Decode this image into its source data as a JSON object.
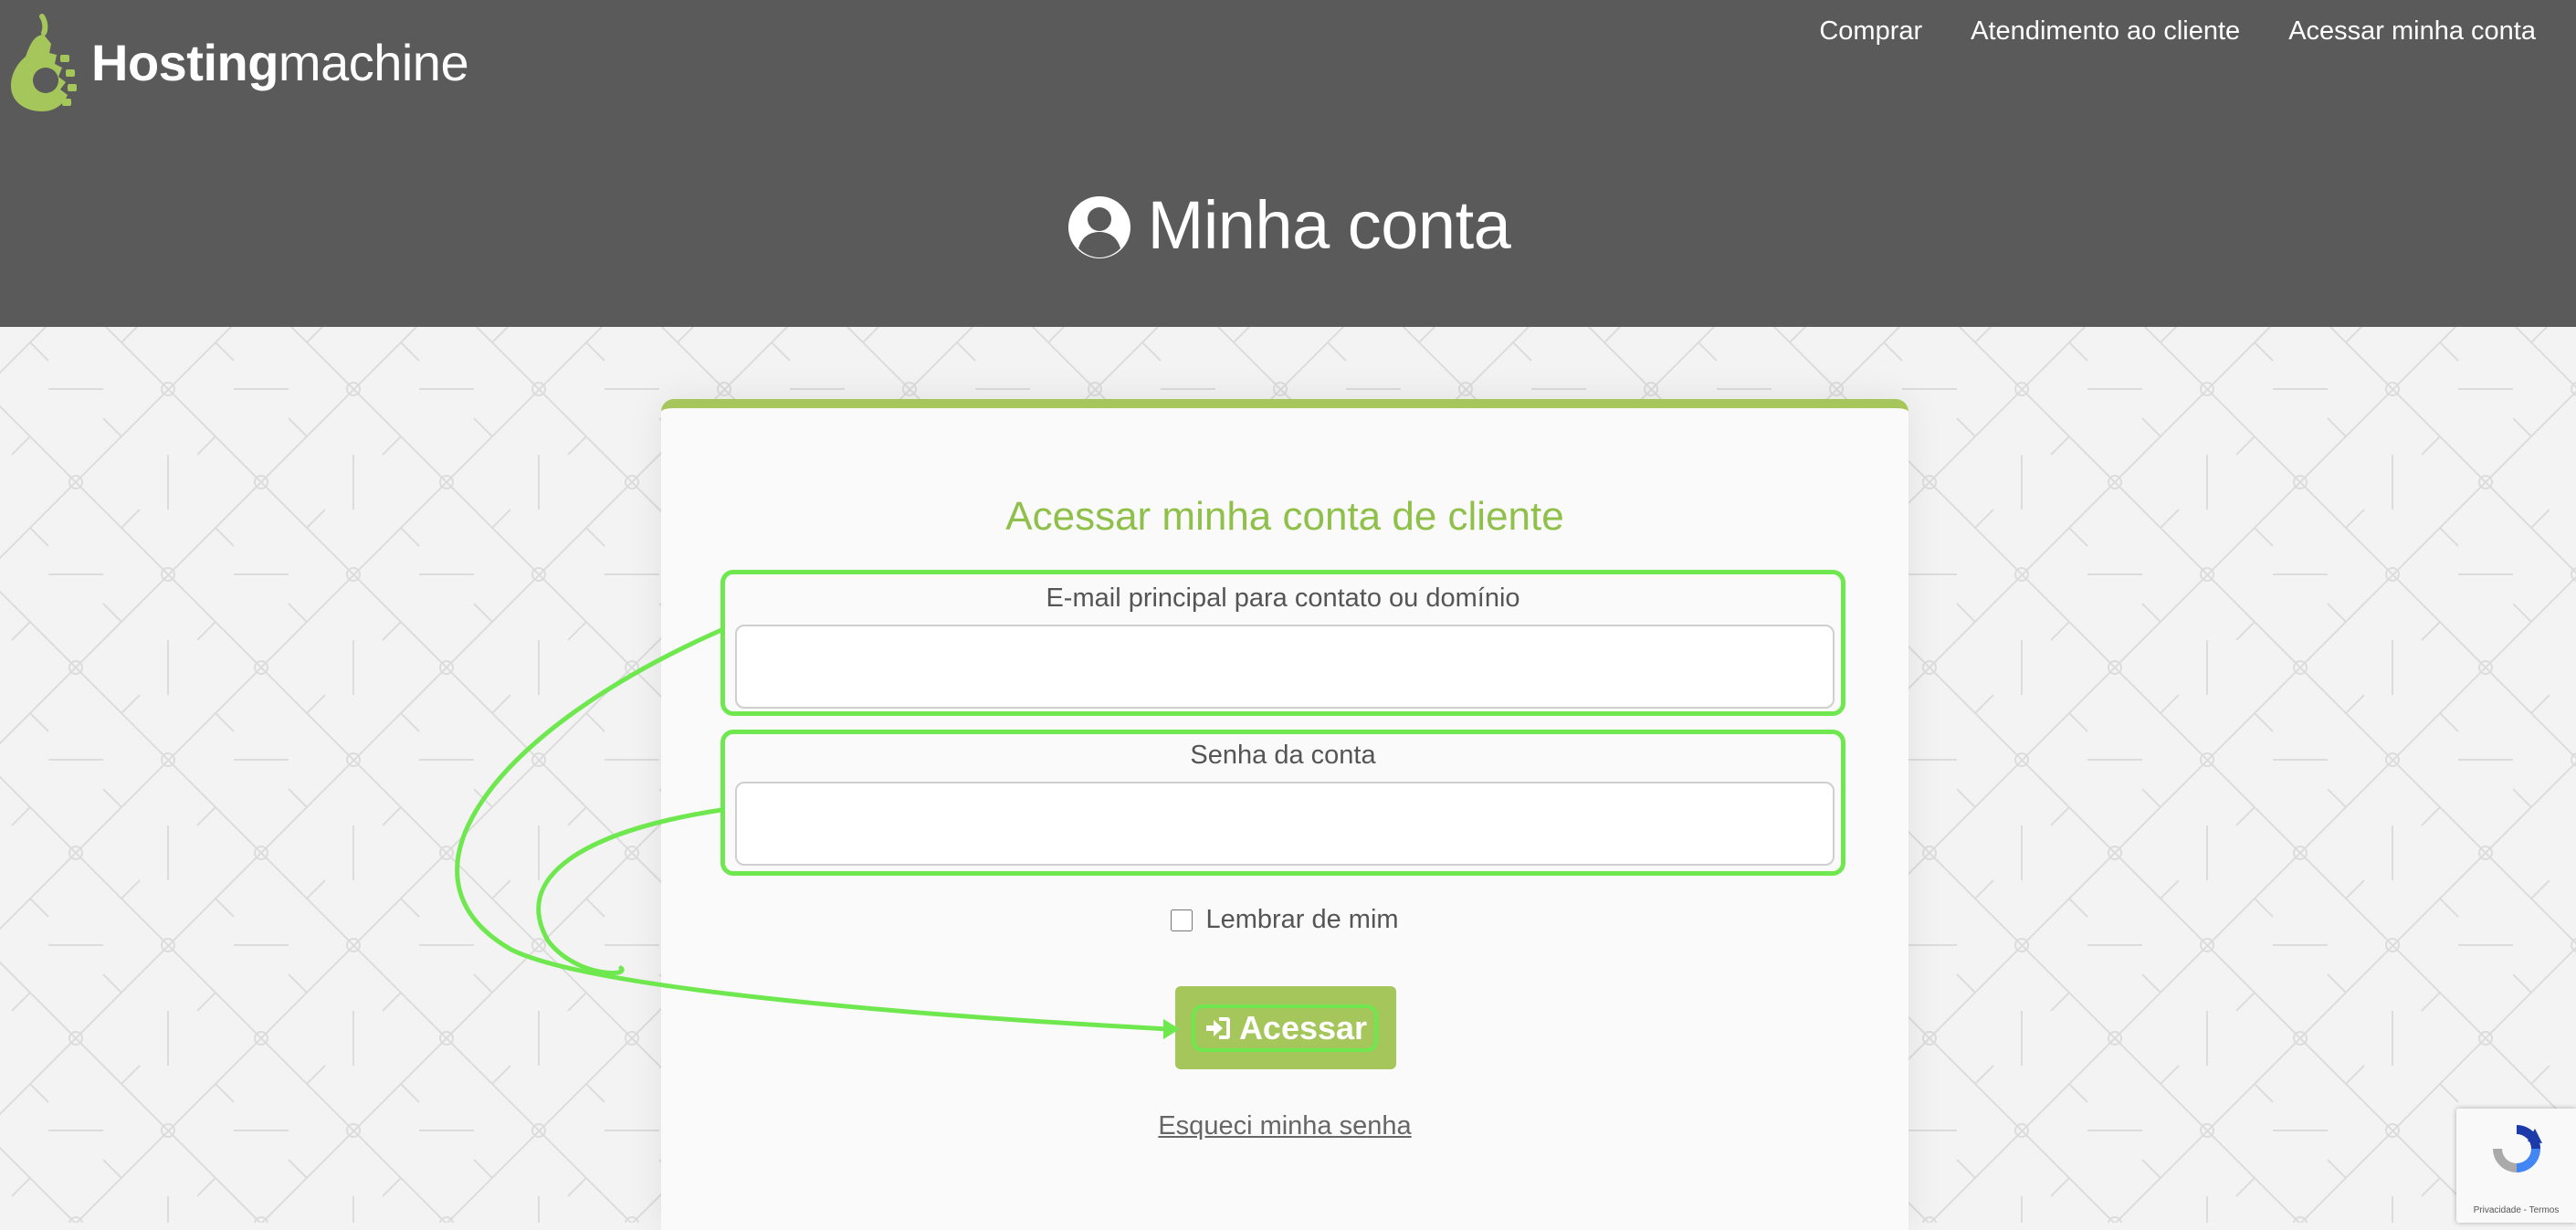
{
  "header": {
    "logo_bold": "Hosting",
    "logo_light": "machine",
    "nav": [
      {
        "label": "Comprar"
      },
      {
        "label": "Atendimento ao cliente"
      },
      {
        "label": "Acessar minha conta"
      }
    ],
    "page_title": "Minha conta"
  },
  "login": {
    "title": "Acessar minha conta de cliente",
    "email_label": "E-mail principal para contato ou domínio",
    "email_value": "",
    "password_label": "Senha da conta",
    "password_value": "",
    "remember_label": "Lembrar de mim",
    "submit_label": "Acessar",
    "forgot_label": "Esqueci minha senha"
  },
  "recaptcha": {
    "links_text": "Privacidade - Termos"
  },
  "colors": {
    "header_bg": "#5a5a5a",
    "brand_green": "#a4c65a",
    "title_green": "#8fc04a",
    "highlight_green": "#6fe84f"
  },
  "icons": {
    "logo": "pear-gear-logo",
    "title": "user-circle-icon",
    "submit": "sign-in-icon"
  }
}
